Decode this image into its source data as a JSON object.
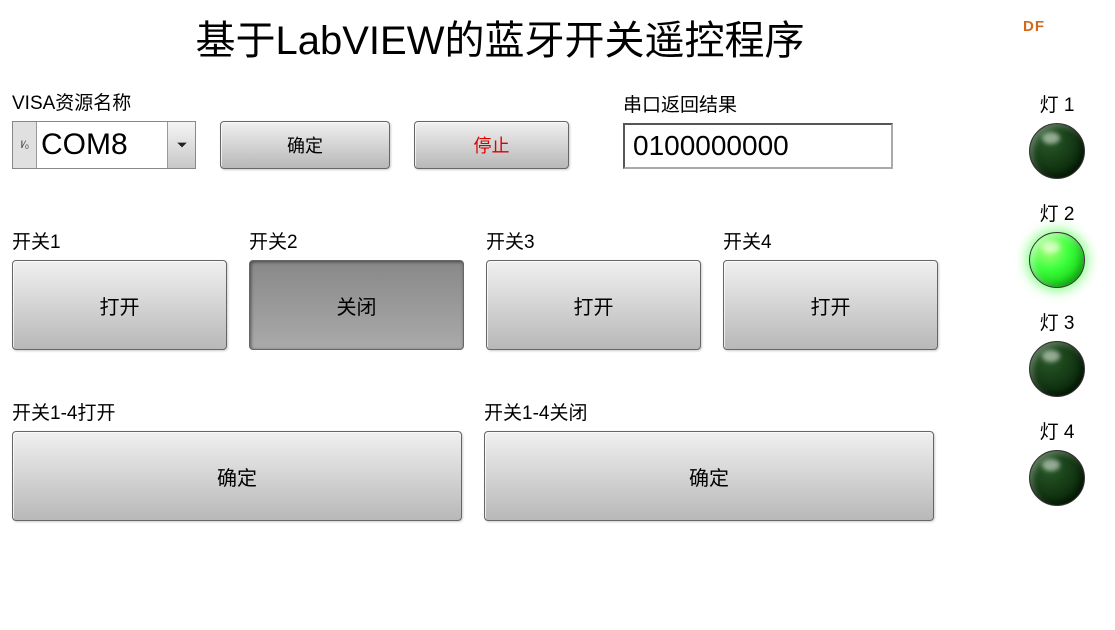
{
  "title": "基于LabVIEW的蓝牙开关遥控程序",
  "df_label": "DF",
  "visa": {
    "label": "VISA资源名称",
    "io_glyph": "I⁄₀",
    "value": "COM8"
  },
  "confirm_button": "确定",
  "stop_button": "停止",
  "serial_result": {
    "label": "串口返回结果",
    "value": "0100000000"
  },
  "switches": [
    {
      "label": "开关1",
      "button": "打开",
      "pressed": false
    },
    {
      "label": "开关2",
      "button": "关闭",
      "pressed": true
    },
    {
      "label": "开关3",
      "button": "打开",
      "pressed": false
    },
    {
      "label": "开关4",
      "button": "打开",
      "pressed": false
    }
  ],
  "all_open": {
    "label": "开关1-4打开",
    "button": "确定"
  },
  "all_close": {
    "label": "开关1-4关闭",
    "button": "确定"
  },
  "leds": [
    {
      "label": "灯 1",
      "on": false
    },
    {
      "label": "灯 2",
      "on": true
    },
    {
      "label": "灯 3",
      "on": false
    },
    {
      "label": "灯 4",
      "on": false
    }
  ]
}
